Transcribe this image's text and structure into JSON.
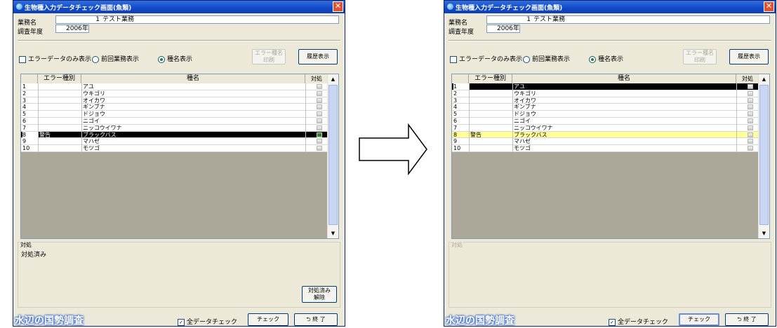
{
  "arrow": {
    "color": "#000000"
  },
  "left": {
    "title": "生物種入力データチェック画面(魚類)",
    "gyomu_label": "業務名",
    "gyomu_num": "1",
    "gyomu_name": "テスト業務",
    "year_label": "調査年度",
    "year_value": "2006年",
    "opt_error_only": "エラーデータのみ表示",
    "opt_prev": "前回業務表示",
    "opt_species": "種名表示",
    "btn_error_print": "エラー種名\n印刷",
    "btn_history": "履歴表示",
    "col_error": "エラー種別",
    "col_name": "種名",
    "col_taio": "対処",
    "rows": [
      {
        "num": "1",
        "err": "",
        "name": "アユ"
      },
      {
        "num": "2",
        "err": "",
        "name": "ウキゴリ"
      },
      {
        "num": "3",
        "err": "",
        "name": "オイカワ"
      },
      {
        "num": "4",
        "err": "",
        "name": "ギンブナ"
      },
      {
        "num": "5",
        "err": "",
        "name": "ドジョウ"
      },
      {
        "num": "6",
        "err": "",
        "name": "ニゴイ"
      },
      {
        "num": "7",
        "err": "",
        "name": "ニッコウイワナ"
      },
      {
        "num": "8",
        "err": "警告",
        "name": "ブラックバス"
      },
      {
        "num": "9",
        "err": "",
        "name": "マハゼ"
      },
      {
        "num": "10",
        "err": "",
        "name": "モツゴ"
      }
    ],
    "taio_group": "対処",
    "taio_text": "対処済み",
    "btn_taio_clear": "対処済み\n解除",
    "logo": "水辺の国勢調査",
    "all_check": "全データチェック",
    "btn_check": "チェック",
    "btn_close": "終 了"
  },
  "right": {
    "title": "生物種入力データチェック画面(魚類)",
    "gyomu_label": "業務名",
    "gyomu_num": "1",
    "gyomu_name": "テスト業務",
    "year_label": "調査年度",
    "year_value": "2006年",
    "opt_error_only": "エラーデータのみ表示",
    "opt_prev": "前回業務表示",
    "opt_species": "種名表示",
    "btn_error_print": "エラー種名\n印刷",
    "btn_history": "履歴表示",
    "col_error": "エラー種別",
    "col_name": "種名",
    "col_taio": "対処",
    "rows": [
      {
        "num": "1",
        "err": "",
        "name": "アユ"
      },
      {
        "num": "2",
        "err": "",
        "name": "ウキゴリ"
      },
      {
        "num": "3",
        "err": "",
        "name": "オイカワ"
      },
      {
        "num": "4",
        "err": "",
        "name": "ギンブナ"
      },
      {
        "num": "5",
        "err": "",
        "name": "ドジョウ"
      },
      {
        "num": "6",
        "err": "",
        "name": "ニゴイ"
      },
      {
        "num": "7",
        "err": "",
        "name": "ニッコウイワナ"
      },
      {
        "num": "8",
        "err": "警告",
        "name": "ブラックバス"
      },
      {
        "num": "9",
        "err": "",
        "name": "マハゼ"
      },
      {
        "num": "10",
        "err": "",
        "name": "モツゴ"
      }
    ],
    "taio_group": "対処",
    "logo": "水辺の国勢調査",
    "all_check": "全データチェック",
    "btn_check": "チェック",
    "btn_close": "終 了"
  }
}
